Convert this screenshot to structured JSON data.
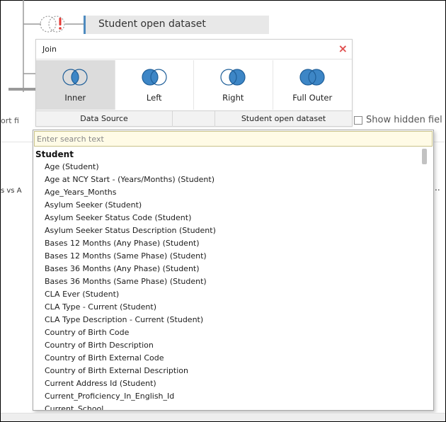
{
  "flow": {
    "dataset_label": "Student open dataset"
  },
  "background": {
    "left_fragment": "ort fi",
    "left_fragment2": "s vs A",
    "show_hidden": "Show hidden fiel",
    "ellipsis": ".."
  },
  "join": {
    "title": "Join",
    "close_glyph": "×",
    "types": [
      {
        "label": "Inner",
        "selected": true
      },
      {
        "label": "Left",
        "selected": false
      },
      {
        "label": "Right",
        "selected": false
      },
      {
        "label": "Full Outer",
        "selected": false
      }
    ],
    "header": {
      "source": "Data Source",
      "target": "Student open dataset"
    }
  },
  "field_picker": {
    "search_placeholder": "Enter search text",
    "group": "Student",
    "items": [
      "Age (Student)",
      "Age at NCY Start - (Years/Months) (Student)",
      "Age_Years_Months",
      "Asylum Seeker (Student)",
      "Asylum Seeker Status Code (Student)",
      "Asylum Seeker Status Description (Student)",
      "Bases 12 Months (Any Phase) (Student)",
      "Bases 12 Months (Same Phase) (Student)",
      "Bases 36 Months (Any Phase) (Student)",
      "Bases 36 Months (Same Phase) (Student)",
      "CLA Ever (Student)",
      "CLA Type - Current (Student)",
      "CLA Type Description - Current (Student)",
      "Country of Birth Code",
      "Country of Birth Description",
      "Country of Birth External Code",
      "Country of Birth External Description",
      "Current Address Id (Student)",
      "Current_Proficiency_In_English_Id",
      "Current_School"
    ]
  },
  "colors": {
    "venn_fill": "#3d86c6",
    "venn_stroke": "#1f5f99",
    "accent_bar": "#4e8bbf",
    "close_red": "#e05050",
    "warning_red": "#e53935",
    "search_bg": "#fffbe6"
  },
  "icons": {
    "join": "join-venn-icon",
    "warning": "warning-exclamation-icon",
    "close": "close-icon"
  }
}
